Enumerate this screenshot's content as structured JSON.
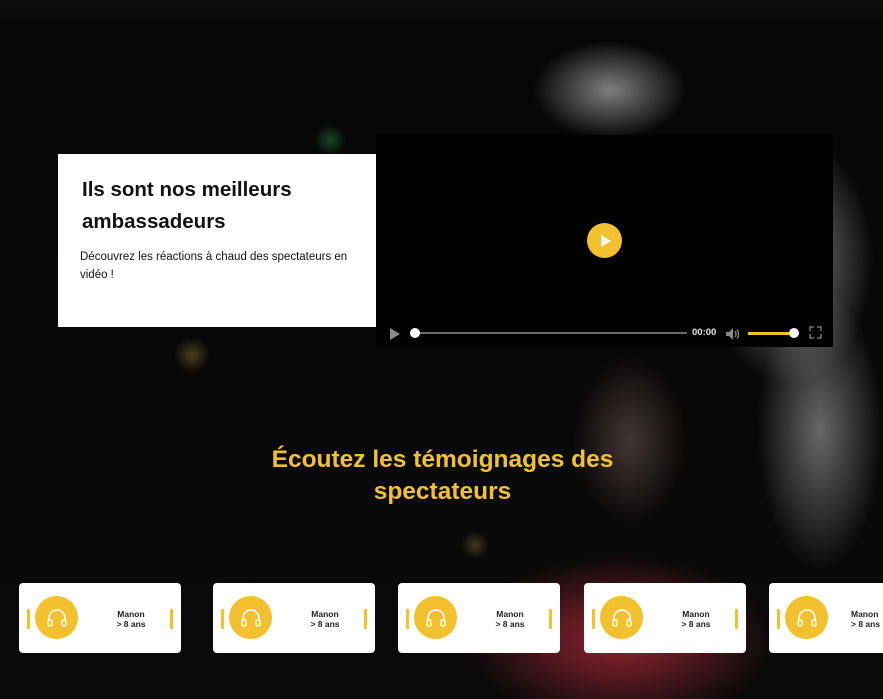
{
  "intro": {
    "title": "Ils sont nos meilleurs ambassadeurs",
    "text": "Découvrez les réactions à chaud des spectateurs en vidéo !"
  },
  "video": {
    "time": "00:00",
    "volume_level": 1.0,
    "progress": 0
  },
  "section": {
    "heading": "Écoutez les témoignages des spectateurs"
  },
  "testimonials": [
    {
      "name": "Manon",
      "age": "> 8 ans",
      "icon": "headphones-icon"
    },
    {
      "name": "Manon",
      "age": "> 8 ans",
      "icon": "headphones-icon"
    },
    {
      "name": "Manon",
      "age": "> 8 ans",
      "icon": "headphones-icon"
    },
    {
      "name": "Manon",
      "age": "> 8 ans",
      "icon": "headphones-icon"
    },
    {
      "name": "Manon",
      "age": "> 8 ans",
      "icon": "headphones-icon"
    }
  ],
  "colors": {
    "accent": "#f3c12f",
    "card": "#ffffff",
    "background": "#000000"
  }
}
